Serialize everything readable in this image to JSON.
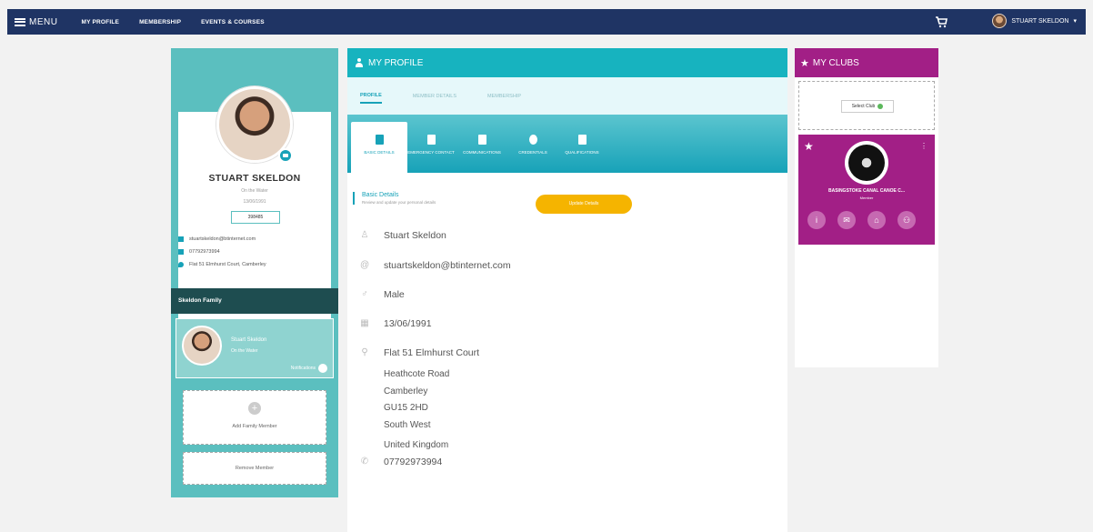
{
  "topnav": {
    "menu_label": "MENU",
    "links": [
      "MY PROFILE",
      "MEMBERSHIP",
      "EVENTS & COURSES"
    ],
    "user_name": "STUART SKELDON"
  },
  "left": {
    "name": "STUART SKELDON",
    "role": "On the Water",
    "dob_small": "13/06/1991",
    "member_id": "398485",
    "email": "stuartskeldon@btinternet.com",
    "phone": "07792973994",
    "address": "Flat 51 Elmhurst Court, Camberley",
    "family_title": "Skeldon Family",
    "member_card": {
      "name": "Stuart Skeldon",
      "role": "On the Water",
      "notifications": "Notifications"
    },
    "add_family": "Add Family Member",
    "remove_member": "Remove Member"
  },
  "center": {
    "title": "MY PROFILE",
    "tabs": [
      "PROFILE",
      "MEMBER DETAILS",
      "MEMBERSHIP"
    ],
    "subtabs": [
      "BASIC DETAILS",
      "EMERGENCY CONTACT",
      "COMMUNICATIONS",
      "CREDENTIALS",
      "QUALIFICATIONS"
    ],
    "basic_title": "Basic Details",
    "basic_sub": "Review and update your personal details",
    "update_button": "Update Details",
    "name": "Stuart Skeldon",
    "email": "stuartskeldon@btinternet.com",
    "gender": "Male",
    "dob": "13/06/1991",
    "address_line1": "Flat 51 Elmhurst Court",
    "address_lines": [
      "Heathcote Road",
      "Camberley",
      "GU15 2HD",
      "South West",
      "United Kingdom"
    ],
    "phone": "07792973994"
  },
  "right": {
    "title": "MY CLUBS",
    "select_club": "Select Club",
    "club_name": "BASINGSTOKE CANAL CANOE C...",
    "club_role": "Member"
  }
}
